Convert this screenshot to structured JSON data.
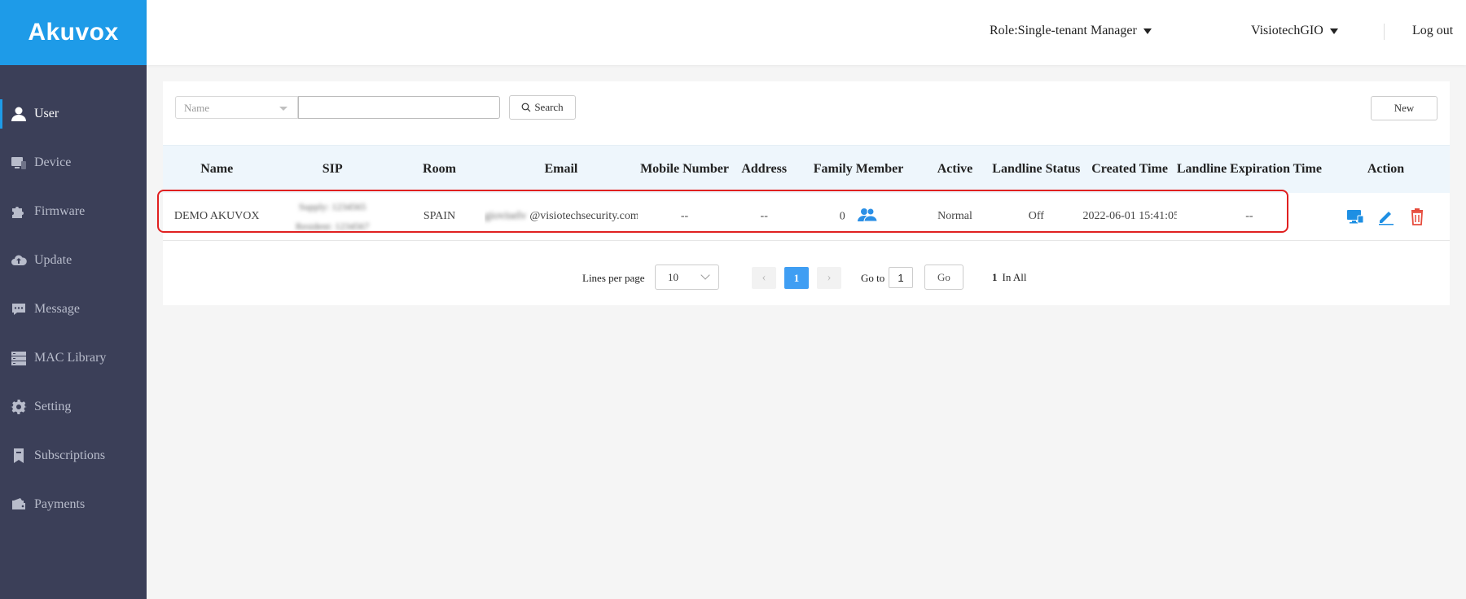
{
  "brand": {
    "logo_text": "Akuvox",
    "accent_color": "#1e9be8",
    "sidebar_bg": "#3b3f58"
  },
  "header": {
    "role": "Role:Single-tenant Manager",
    "account": "VisiotechGIO",
    "logout": "Log out"
  },
  "sidebar": {
    "items": [
      {
        "label": "User",
        "icon": "user-icon",
        "active": true
      },
      {
        "label": "Device",
        "icon": "device-icon"
      },
      {
        "label": "Firmware",
        "icon": "puzzle-icon"
      },
      {
        "label": "Update",
        "icon": "cloud-upload-icon"
      },
      {
        "label": "Message",
        "icon": "chat-icon"
      },
      {
        "label": "MAC Library",
        "icon": "server-icon"
      },
      {
        "label": "Setting",
        "icon": "gear-icon"
      },
      {
        "label": "Subscriptions",
        "icon": "bookmark-icon"
      },
      {
        "label": "Payments",
        "icon": "wallet-icon"
      }
    ]
  },
  "toolbar": {
    "filter_selected": "Name",
    "search_value": "",
    "search_label": "Search",
    "new_label": "New"
  },
  "table": {
    "columns": [
      "Name",
      "SIP",
      "Room",
      "Email",
      "Mobile Number",
      "Address",
      "Family Member",
      "Active",
      "Landline Status",
      "Created Time",
      "Landline Expiration Time",
      "Action"
    ],
    "rows": [
      {
        "name": "DEMO AKUVOX",
        "sip_line1": "Supply: 1234565",
        "sip_line2": "Resident: 1234567",
        "room": "SPAIN",
        "email_user": "gioviselv",
        "email_domain": "@visiotechsecurity.com",
        "mobile": "--",
        "address": "--",
        "family_count": "0",
        "active": "Normal",
        "landline_status": "Off",
        "created_time": "2022-06-01 15:41:05",
        "landline_expiration": "--"
      }
    ]
  },
  "pagination": {
    "lines_label": "Lines per page",
    "lines_value": "10",
    "prev": "‹",
    "current_page": "1",
    "next": "›",
    "goto_label": "Go to",
    "goto_value": "1",
    "go_label": "Go",
    "total": "1",
    "total_label": "In All"
  }
}
